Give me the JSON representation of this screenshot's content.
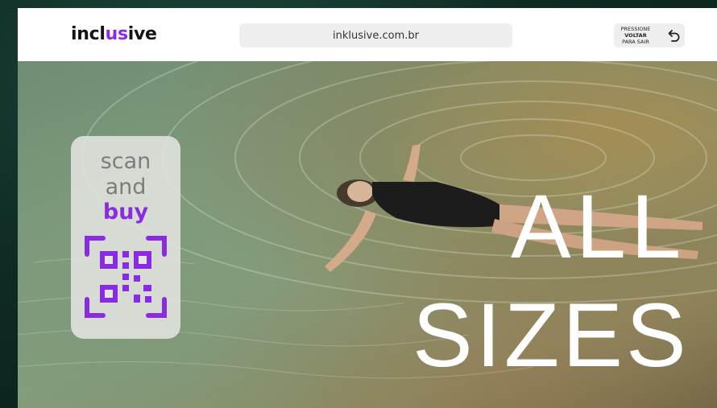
{
  "header": {
    "logo": {
      "before": "incl",
      "accent": "us",
      "after": "ive"
    },
    "url": "inklusive.com.br",
    "exit_button": {
      "line1": "PRESSIONE",
      "line2": "VOLTAR",
      "line3": "PARA SAIR",
      "icon": "back-arrow-icon"
    }
  },
  "ad": {
    "cta": {
      "line1": "scan",
      "line2": "and",
      "line3": "buy",
      "icon": "qr-code-icon"
    },
    "headline": {
      "line1": "ALL",
      "line2": "SIZES"
    }
  },
  "colors": {
    "brand_accent": "#8a2be2",
    "headline": "#ffffff",
    "card_bg": "#e4e6e2"
  }
}
